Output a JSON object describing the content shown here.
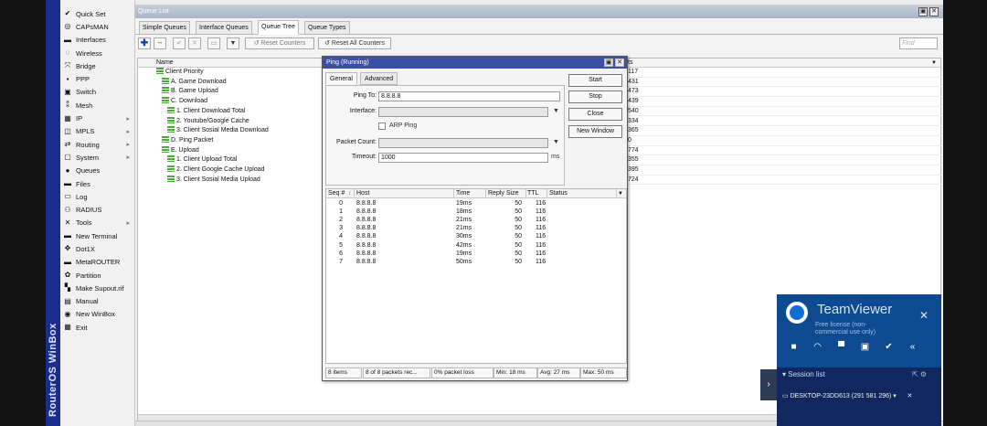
{
  "sidebar_brand": "RouterOS WinBox",
  "menu": [
    {
      "label": "Quick Set",
      "icon": "quick-set-icon",
      "glyph": "✔",
      "arrow": false
    },
    {
      "label": "CAPsMAN",
      "icon": "capsman-icon",
      "glyph": "◎",
      "arrow": false
    },
    {
      "label": "Interfaces",
      "icon": "interfaces-icon",
      "glyph": "▬",
      "arrow": false
    },
    {
      "label": "Wireless",
      "icon": "wireless-icon",
      "glyph": "◌",
      "arrow": false
    },
    {
      "label": "Bridge",
      "icon": "bridge-icon",
      "glyph": "⤧",
      "arrow": false
    },
    {
      "label": "PPP",
      "icon": "ppp-icon",
      "glyph": "▪",
      "arrow": false
    },
    {
      "label": "Switch",
      "icon": "switch-icon",
      "glyph": "▣",
      "arrow": false
    },
    {
      "label": "Mesh",
      "icon": "mesh-icon",
      "glyph": "⁑",
      "arrow": false
    },
    {
      "label": "IP",
      "icon": "ip-icon",
      "glyph": "▦",
      "arrow": true
    },
    {
      "label": "MPLS",
      "icon": "mpls-icon",
      "glyph": "◫",
      "arrow": true
    },
    {
      "label": "Routing",
      "icon": "routing-icon",
      "glyph": "⇄",
      "arrow": true
    },
    {
      "label": "System",
      "icon": "system-icon",
      "glyph": "▢",
      "arrow": true
    },
    {
      "label": "Queues",
      "icon": "queues-icon",
      "glyph": "●",
      "arrow": false
    },
    {
      "label": "Files",
      "icon": "files-icon",
      "glyph": "▬",
      "arrow": false
    },
    {
      "label": "Log",
      "icon": "log-icon",
      "glyph": "▭",
      "arrow": false
    },
    {
      "label": "RADIUS",
      "icon": "radius-icon",
      "glyph": "⚇",
      "arrow": false
    },
    {
      "label": "Tools",
      "icon": "tools-icon",
      "glyph": "✕",
      "arrow": true
    },
    {
      "label": "New Terminal",
      "icon": "terminal-icon",
      "glyph": "▬",
      "arrow": false
    },
    {
      "label": "Dot1X",
      "icon": "dot1x-icon",
      "glyph": "✥",
      "arrow": false
    },
    {
      "label": "MetaROUTER",
      "icon": "metarouter-icon",
      "glyph": "▬",
      "arrow": false
    },
    {
      "label": "Partition",
      "icon": "partition-icon",
      "glyph": "✿",
      "arrow": false
    },
    {
      "label": "Make Supout.rif",
      "icon": "supout-icon",
      "glyph": "▚",
      "arrow": false
    },
    {
      "label": "Manual",
      "icon": "manual-icon",
      "glyph": "▤",
      "arrow": false
    },
    {
      "label": "New WinBox",
      "icon": "winbox-icon",
      "glyph": "◉",
      "arrow": false
    },
    {
      "label": "Exit",
      "icon": "exit-icon",
      "glyph": "▦",
      "arrow": false
    }
  ],
  "queue_window": {
    "title": "Queue List",
    "tabs": [
      "Simple Queues",
      "Interface Queues",
      "Queue Tree",
      "Queue Types"
    ],
    "active_tab": "Queue Tree",
    "toolbar": {
      "reset_counters": "Reset Counters",
      "reset_all_counters": "Reset All Counters",
      "find_placeholder": "Find"
    },
    "column_name": "Name",
    "column_rate": "ts",
    "rows": [
      {
        "name": "Client Priority",
        "indent": 0
      },
      {
        "name": "A. Game Download",
        "indent": 1
      },
      {
        "name": "B. Game Upload",
        "indent": 1
      },
      {
        "name": "C. Download",
        "indent": 1
      },
      {
        "name": "1. Client Download Total",
        "indent": 2
      },
      {
        "name": "2. Youtube/Google Cache",
        "indent": 2
      },
      {
        "name": "3. Client Sosial Media Download",
        "indent": 2
      },
      {
        "name": "D. Ping Packet",
        "indent": 1
      },
      {
        "name": "E. Upload",
        "indent": 1
      },
      {
        "name": "1. Client Upload Total",
        "indent": 2
      },
      {
        "name": "2. Client Google Cache Upload",
        "indent": 2
      },
      {
        "name": "3. Client Sosial Media Upload",
        "indent": 2
      }
    ],
    "rates": [
      "117",
      "431",
      "473",
      "439",
      "540",
      "334",
      "365",
      "0",
      "774",
      "355",
      "395",
      "724"
    ]
  },
  "ping": {
    "title": "Ping (Running)",
    "tabs": [
      "General",
      "Advanced"
    ],
    "active_tab": "General",
    "labels": {
      "ping_to": "Ping To:",
      "interface": "Interface:",
      "arp_ping": "ARP Ping",
      "packet_count": "Packet Count:",
      "timeout": "Timeout:",
      "ms": "ms"
    },
    "values": {
      "ping_to": "8.8.8.8",
      "interface": "",
      "packet_count": "",
      "timeout": "1000"
    },
    "buttons": [
      "Start",
      "Stop",
      "Close",
      "New Window"
    ],
    "columns": {
      "seq": "Seq #",
      "host": "Host",
      "time": "Time",
      "reply_size": "Reply Size",
      "ttl": "TTL",
      "status": "Status"
    },
    "results": [
      {
        "seq": "0",
        "host": "8.8.8.8",
        "time": "19ms",
        "size": "50",
        "ttl": "116"
      },
      {
        "seq": "1",
        "host": "8.8.8.8",
        "time": "18ms",
        "size": "50",
        "ttl": "116"
      },
      {
        "seq": "2",
        "host": "8.8.8.8",
        "time": "21ms",
        "size": "50",
        "ttl": "116"
      },
      {
        "seq": "3",
        "host": "8.8.8.8",
        "time": "21ms",
        "size": "50",
        "ttl": "116"
      },
      {
        "seq": "4",
        "host": "8.8.8.8",
        "time": "30ms",
        "size": "50",
        "ttl": "116"
      },
      {
        "seq": "5",
        "host": "8.8.8.8",
        "time": "42ms",
        "size": "50",
        "ttl": "116"
      },
      {
        "seq": "6",
        "host": "8.8.8.8",
        "time": "19ms",
        "size": "50",
        "ttl": "116"
      },
      {
        "seq": "7",
        "host": "8.8.8.8",
        "time": "50ms",
        "size": "50",
        "ttl": "116"
      }
    ],
    "status": {
      "items": "8 items",
      "packets": "8 of 8 packets rec...",
      "loss": "0% packet loss",
      "min": "Min: 18 ms",
      "avg": "Avg: 27 ms",
      "max": "Max: 50 ms"
    }
  },
  "teamviewer": {
    "title": "TeamViewer",
    "license": "Free license (non-commercial use only)",
    "session_list": "Session list",
    "session": "DESKTOP-23DD613 (291 581 296)"
  },
  "colors": {
    "winbox_band": "#1a2c8c",
    "ping_title": "#3c4fa8",
    "teamviewer": "#0e4a8f",
    "queue_icon": "#4caa3a"
  }
}
